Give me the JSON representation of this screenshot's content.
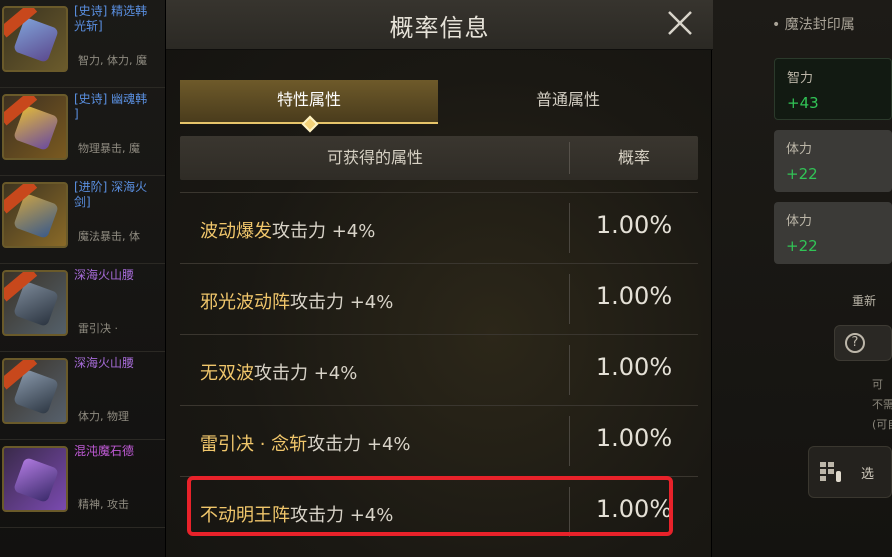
{
  "dialog": {
    "title": "概率信息",
    "tabs": [
      {
        "label": "特性属性",
        "active": true
      },
      {
        "label": "普通属性",
        "active": false
      }
    ],
    "table": {
      "columns": [
        "可获得的属性",
        "概率"
      ],
      "rows": [
        {
          "skill": "波动爆发",
          "effect": "攻击力 +4%",
          "probability": "1.00%"
        },
        {
          "skill": "邪光波动阵",
          "effect": "攻击力 +4%",
          "probability": "1.00%"
        },
        {
          "skill": "无双波",
          "effect": "攻击力 +4%",
          "probability": "1.00%"
        },
        {
          "skill": "雷引决 · 念斩",
          "effect": "攻击力 +4%",
          "probability": "1.00%"
        },
        {
          "skill": "不动明王阵",
          "effect": "攻击力 +4%",
          "probability": "1.00%",
          "highlighted": true
        }
      ]
    },
    "colors": {
      "highlight": "#e8222a",
      "skill_text": "#f0c66b",
      "accent_gold": "#e6c46a"
    }
  },
  "left_list": {
    "items": [
      {
        "name": "[史诗] 精选韩",
        "name2": "光斩]",
        "sub": "智力, 体力, 魔",
        "name_color": "#5a8fe0"
      },
      {
        "name": "[史诗] 幽魂韩",
        "name2": "]",
        "sub": "物理暴击, 魔",
        "name_color": "#5a8fe0"
      },
      {
        "name": "[进阶] 深海火",
        "name2": "剑]",
        "sub": "魔法暴击, 体",
        "name_color": "#5a8fe0"
      },
      {
        "name": "深海火山腰",
        "name2": "",
        "sub": "雷引决 ·",
        "name_color": "#a66bd8"
      },
      {
        "name": "深海火山腰",
        "name2": "",
        "sub": "体力, 物理",
        "name_color": "#a66bd8"
      },
      {
        "name": "混沌魔石德",
        "name2": "",
        "sub": "精神, 攻击",
        "name_color": "#c05ad6"
      }
    ]
  },
  "right_panel": {
    "title": "• 魔法封印属",
    "stats": [
      {
        "label": "智力",
        "value": "+43"
      },
      {
        "label": "体力",
        "value": "+22"
      },
      {
        "label": "体力",
        "value": "+22"
      }
    ],
    "reset_label": "重新",
    "notes": [
      "可",
      "不需",
      "(可自"
    ],
    "select_label": "选"
  }
}
